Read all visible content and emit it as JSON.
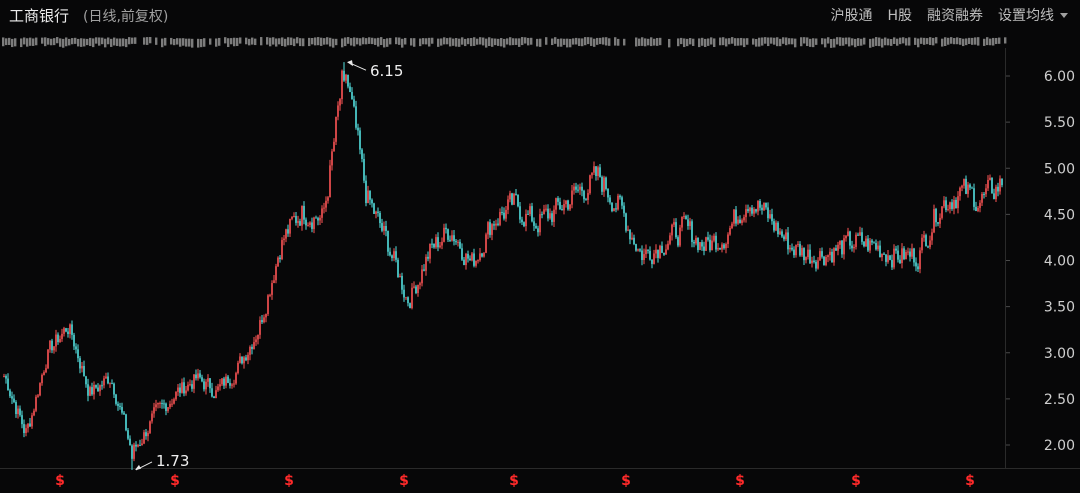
{
  "header": {
    "title": "工商银行",
    "subtitle": "(日线,前复权)",
    "menu": [
      "沪股通",
      "H股",
      "融资融券",
      "设置均线"
    ]
  },
  "colors": {
    "background": "#070708",
    "up": "#ff5555",
    "down": "#54e1e1",
    "axis_text": "#cfcfcf",
    "dividend_marker": "#ff2a2a"
  },
  "icons": {
    "dividend_marker": "dollar-sign",
    "settings_dropdown": "caret-down"
  },
  "chart_data": {
    "type": "candlestick",
    "title": "工商银行",
    "subtitle": "(日线,前复权)",
    "ylim": [
      1.6,
      6.3
    ],
    "yticks": [
      "6.00",
      "5.50",
      "5.00",
      "4.50",
      "4.00",
      "3.50",
      "3.00",
      "2.50",
      "2.00"
    ],
    "annotations": [
      {
        "label": "6.15",
        "value": 6.15,
        "note": "period high"
      },
      {
        "label": "1.73",
        "value": 1.73,
        "note": "period low"
      }
    ],
    "markers": [
      "$",
      "$",
      "$",
      "$",
      "$",
      "$",
      "$",
      "$",
      "$"
    ],
    "trend": [
      2.75,
      2.1,
      3.0,
      3.3,
      2.55,
      2.75,
      1.9,
      2.3,
      2.55,
      2.72,
      2.58,
      2.85,
      3.3,
      4.2,
      4.55,
      4.45,
      6.1,
      4.7,
      4.2,
      3.55,
      4.1,
      4.35,
      3.95,
      4.45,
      4.6,
      4.4,
      4.55,
      4.75,
      4.9,
      4.55,
      4.05,
      4.2,
      4.35,
      4.15,
      4.3,
      4.7,
      4.45,
      4.15,
      4.05,
      4.1,
      4.2,
      4.15,
      4.05,
      4.05,
      4.6,
      4.75,
      4.65,
      4.85
    ]
  }
}
